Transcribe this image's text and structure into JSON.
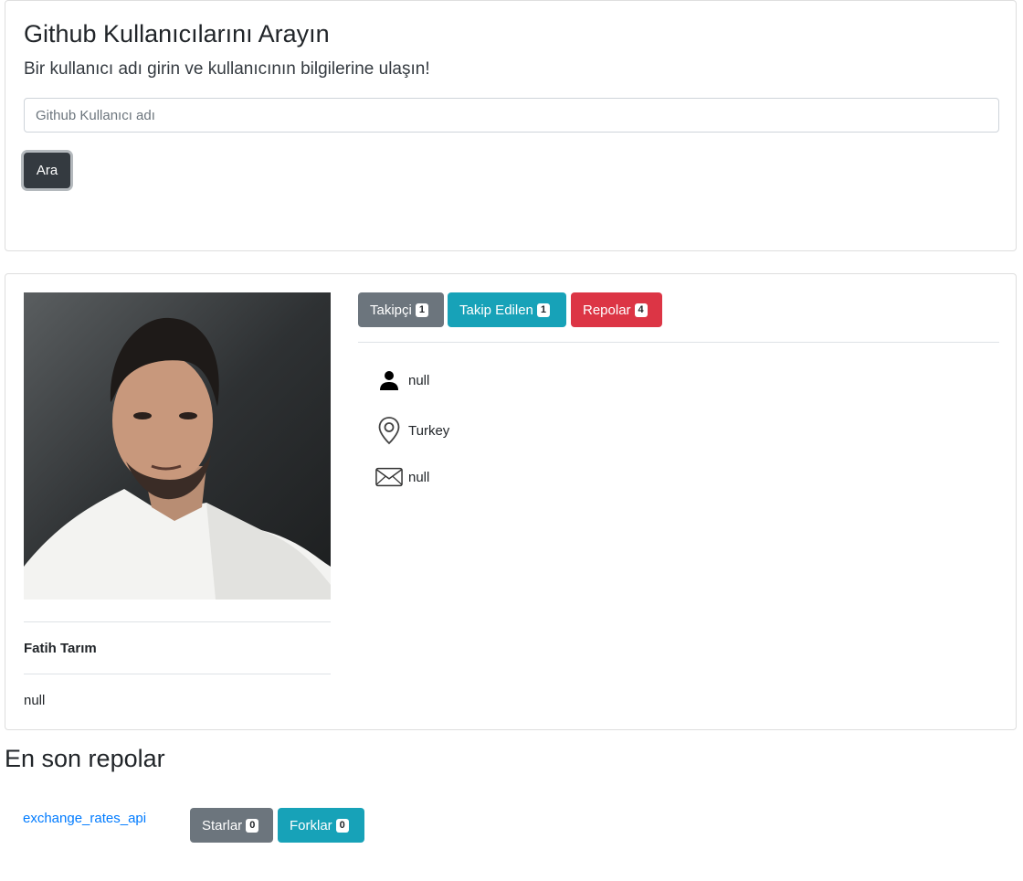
{
  "search": {
    "title": "Github Kullanıcılarını Arayın",
    "subtitle": "Bir kullanıcı adı girin ve kullanıcının bilgilerine ulaşın!",
    "input_placeholder": "Github Kullanıcı adı",
    "input_value": "",
    "button_label": "Ara"
  },
  "profile": {
    "avatar_icon": "user-photo",
    "name": "Fatih Tarım",
    "bio": "null",
    "stats": [
      {
        "label": "Takipçi",
        "count": "1",
        "color": "#6c757d"
      },
      {
        "label": "Takip Edilen",
        "count": "1",
        "color": "#17a2b8"
      },
      {
        "label": "Repolar",
        "count": "4",
        "color": "#dc3545"
      }
    ],
    "info": [
      {
        "icon": "person-icon",
        "text": "null"
      },
      {
        "icon": "location-pin-icon",
        "text": "Turkey"
      },
      {
        "icon": "envelope-icon",
        "text": "null"
      }
    ]
  },
  "repos": {
    "title": "En son repolar",
    "items": [
      {
        "name": "exchange_rates_api",
        "stars_label": "Starlar",
        "stars": "0",
        "forks_label": "Forklar",
        "forks": "0"
      }
    ]
  },
  "colors": {
    "primary": "#007bff",
    "dark": "#343a40",
    "secondary": "#6c757d",
    "info": "#17a2b8",
    "danger": "#dc3545"
  }
}
